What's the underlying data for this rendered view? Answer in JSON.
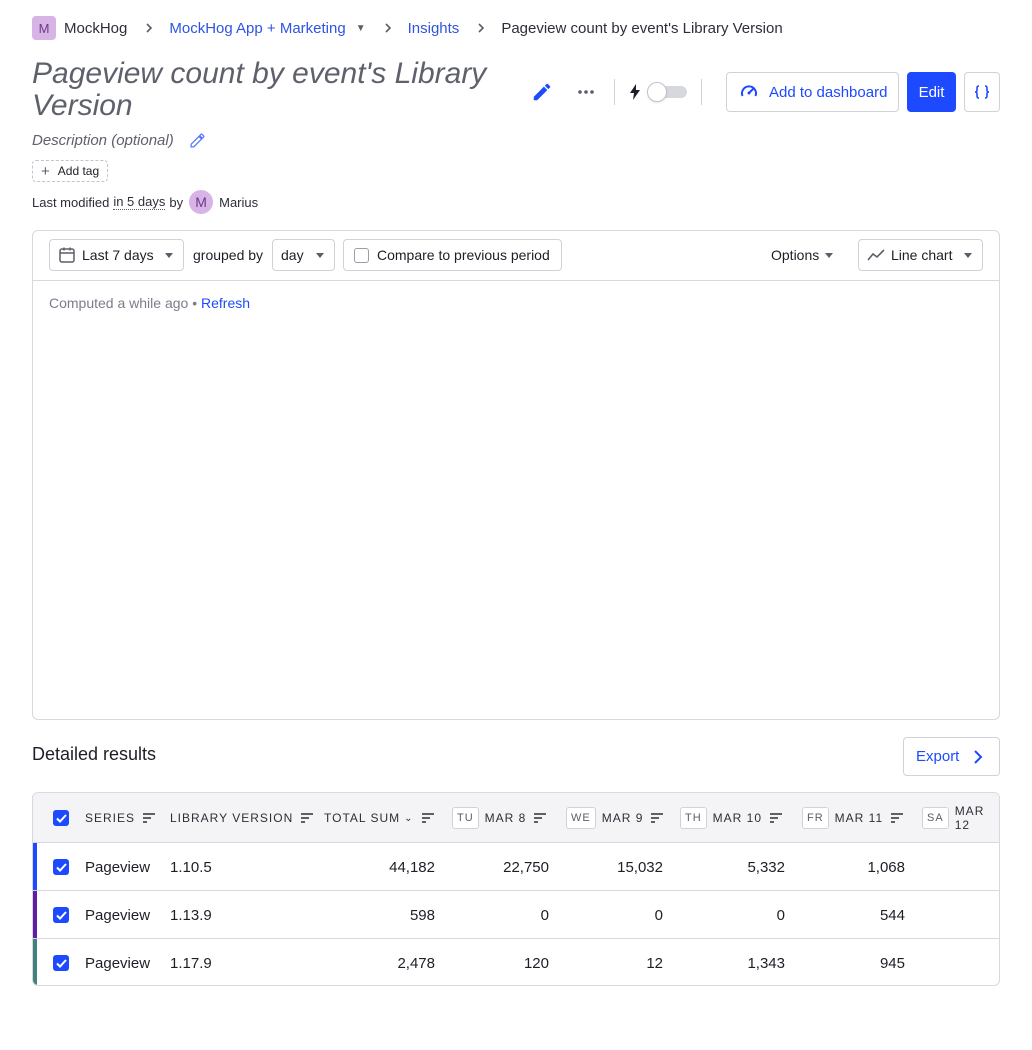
{
  "breadcrumb": {
    "org_avatar": "M",
    "org": "MockHog",
    "project": "MockHog App + Marketing",
    "section": "Insights",
    "current": "Pageview count by event's Library Version"
  },
  "insight": {
    "title": "Pageview count by event's Library Version",
    "description_placeholder": "Description (optional)",
    "add_tag_label": "Add tag",
    "modified_prefix": "Last modified",
    "modified_time": "in 5 days",
    "modified_by_word": "by",
    "author_avatar": "M",
    "author": "Marius"
  },
  "actions": {
    "add_to_dashboard_label": "Add to dashboard",
    "edit_label": "Edit",
    "code_label": "{}",
    "autorefresh_enabled": false
  },
  "toolbar": {
    "date_range": "Last 7 days",
    "grouped_by_label": "grouped by",
    "interval": "day",
    "compare_label": "Compare to previous period",
    "compare_checked": false,
    "options_label": "Options",
    "chart_type": "Line chart"
  },
  "status": {
    "computed": "Computed a while ago",
    "separator": "•",
    "refresh_label": "Refresh"
  },
  "results": {
    "title": "Detailed results",
    "export_label": "Export",
    "headers": {
      "series": "SERIES",
      "library_version": "LIBRARY VERSION",
      "total_sum": "TOTAL SUM",
      "days": [
        {
          "dow": "TU",
          "date": "MAR 8"
        },
        {
          "dow": "WE",
          "date": "MAR 9"
        },
        {
          "dow": "TH",
          "date": "MAR 10"
        },
        {
          "dow": "FR",
          "date": "MAR 11"
        },
        {
          "dow": "SA",
          "date": "MAR 12"
        }
      ]
    },
    "rows": [
      {
        "series": "Pageview",
        "version": "1.10.5",
        "total": "44,182",
        "d0": "22,750",
        "d1": "15,032",
        "d2": "5,332",
        "d3": "1,068",
        "color": "#1d4aff"
      },
      {
        "series": "Pageview",
        "version": "1.13.9",
        "total": "598",
        "d0": "0",
        "d1": "0",
        "d2": "0",
        "d3": "544",
        "color": "#621da6"
      },
      {
        "series": "Pageview",
        "version": "1.17.9",
        "total": "2,478",
        "d0": "120",
        "d1": "12",
        "d2": "1,343",
        "d3": "945",
        "color": "#42827e"
      }
    ]
  }
}
